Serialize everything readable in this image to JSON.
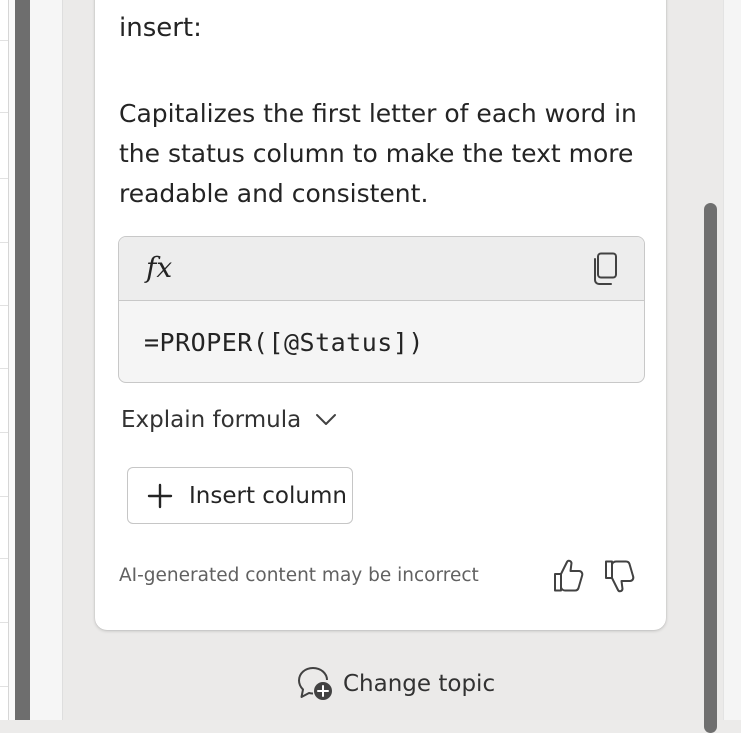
{
  "copilot_card": {
    "intro_text": "insert:",
    "description": "Capitalizes the first letter of each word in the status column to make the text more readable and consistent.",
    "formula": {
      "fx_symbol": "fx",
      "code": "=PROPER([@Status])",
      "copy_icon": "copy-icon"
    },
    "explain_label": "Explain formula",
    "insert_button_label": "Insert column",
    "disclaimer": "AI-generated content may be incorrect",
    "feedback_icons": [
      "thumbs-up-icon",
      "thumbs-down-icon"
    ]
  },
  "footer": {
    "change_topic_label": "Change topic",
    "change_topic_icon": "chat-add-icon"
  },
  "colors": {
    "pane_background": "#ebeae9",
    "card_background": "#ffffff",
    "scrollbar_thumb": "#6f6f6f",
    "formula_box_background": "#f5f5f5"
  }
}
